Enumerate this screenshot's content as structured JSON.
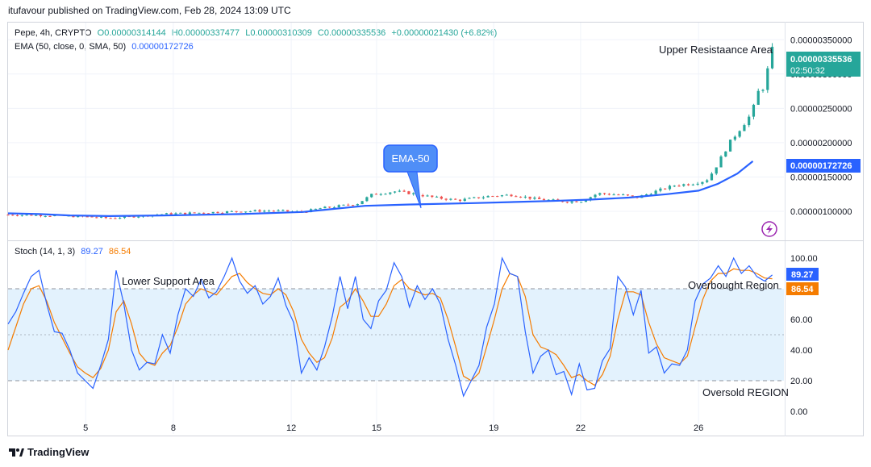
{
  "header": {
    "published": "itufavour published on TradingView.com, Feb 28, 2024 13:09 UTC"
  },
  "legend": {
    "symbol": "Pepe, 4h, CRYPTO",
    "open": "O0.00000314144",
    "high": "H0.00000337477",
    "low": "L0.00000310309",
    "close": "C0.00000335536",
    "change": "+0.00000021430 (+6.82%)",
    "ema_label": "EMA (50, close, 0, SMA, 50)",
    "ema_value": "0.00000172726",
    "stoch_label": "Stoch (14, 1, 3)",
    "stoch_k": "89.27",
    "stoch_d": "86.54"
  },
  "annotations": {
    "upper_resistance": "Upper Resistaance Area",
    "ema_callout": "EMA-50",
    "lower_support": "Lower Support Area",
    "overbought": "Overbought Region",
    "oversold": "Oversold REGION"
  },
  "price_badges": {
    "last_price": "0.00000335536",
    "countdown": "02:50:32",
    "ema_price": "0.00000172726"
  },
  "stoch_badges": {
    "k": "89.27",
    "d": "86.54"
  },
  "footer": {
    "brand": "TradingView"
  },
  "colors": {
    "up": "#26a69a",
    "down": "#ef5350",
    "ema": "#2962ff",
    "stoch_k": "#2962ff",
    "stoch_d": "#f57c00",
    "band": "#e3f2fd",
    "lightning": "#9c27b0"
  },
  "chart_data": [
    {
      "type": "candlestick",
      "title": "Pepe, 4h, CRYPTO",
      "x_tick_labels": [
        "5",
        "8",
        "12",
        "15",
        "19",
        "22",
        "26"
      ],
      "y_tick_labels": [
        "0.00000100000",
        "0.00000150000",
        "0.00000200000",
        "0.00000250000",
        "0.00000300000",
        "0.00000350000"
      ],
      "ylim": [
        6e-07,
        3.75e-06
      ],
      "grid": true,
      "series": [
        {
          "name": "EMA (50, close, 0, SMA, 50)",
          "x": [
            0,
            0.04,
            0.08,
            0.13,
            0.2,
            0.3,
            0.38,
            0.46,
            0.52,
            0.6,
            0.7,
            0.75,
            0.8,
            0.85,
            0.89,
            0.915,
            0.94,
            0.96
          ],
          "values": [
            9.7e-07,
            9.6e-07,
            9.4e-07,
            9.3e-07,
            9.4e-07,
            9.6e-07,
            9.9e-07,
            1.08e-06,
            1.1e-06,
            1.12e-06,
            1.15e-06,
            1.17e-06,
            1.2e-06,
            1.25e-06,
            1.3e-06,
            1.4e-06,
            1.55e-06,
            1.73e-06
          ]
        }
      ],
      "price_path": {
        "x": [
          0.0,
          0.05,
          0.1,
          0.13,
          0.17,
          0.2,
          0.25,
          0.3,
          0.34,
          0.38,
          0.4,
          0.45,
          0.47,
          0.5,
          0.52,
          0.55,
          0.58,
          0.62,
          0.65,
          0.68,
          0.7,
          0.72,
          0.74,
          0.76,
          0.79,
          0.81,
          0.84,
          0.86,
          0.88,
          0.9,
          0.91,
          0.92,
          0.93,
          0.94,
          0.95,
          0.96,
          0.965,
          0.97,
          0.975,
          0.98,
          0.985
        ],
        "values": [
          9.5e-07,
          9.4e-07,
          9.2e-07,
          9e-07,
          9.3e-07,
          9.6e-07,
          9.8e-07,
          1e-06,
          1.01e-06,
          9.9e-07,
          1.04e-06,
          1.11e-06,
          1.25e-06,
          1.29e-06,
          1.26e-06,
          1.2e-06,
          1.16e-06,
          1.22e-06,
          1.24e-06,
          1.18e-06,
          1.16e-06,
          1.14e-06,
          1.15e-06,
          1.26e-06,
          1.24e-06,
          1.2e-06,
          1.31e-06,
          1.38e-06,
          1.4e-06,
          1.45e-06,
          1.6e-06,
          1.8e-06,
          2e-06,
          2.15e-06,
          2.3e-06,
          2.45e-06,
          2.8e-06,
          2.65e-06,
          2.9e-06,
          3.1e-06,
          3.35e-06
        ]
      }
    },
    {
      "type": "line",
      "title": "Stoch (14, 1, 3)",
      "y_tick_labels": [
        "0.00",
        "20.00",
        "40.00",
        "60.00",
        "80.00",
        "100.00"
      ],
      "ylim": [
        0,
        100
      ],
      "bands": [
        20,
        50,
        80
      ],
      "series": [
        {
          "name": "%K",
          "values": [
            57,
            65,
            77,
            88,
            92,
            70,
            52,
            51,
            40,
            25,
            20,
            15,
            30,
            47,
            92,
            70,
            40,
            27,
            32,
            31,
            50,
            38,
            63,
            80,
            75,
            86,
            74,
            78,
            88,
            100,
            85,
            77,
            82,
            70,
            75,
            87,
            69,
            58,
            25,
            35,
            27,
            42,
            62,
            88,
            67,
            88,
            60,
            54,
            72,
            79,
            97,
            88,
            68,
            82,
            73,
            80,
            70,
            47,
            30,
            10,
            20,
            30,
            55,
            70,
            100,
            90,
            88,
            52,
            25,
            36,
            40,
            24,
            26,
            11,
            31,
            14,
            15,
            33,
            41,
            88,
            81,
            63,
            79,
            38,
            42,
            25,
            31,
            30,
            40,
            72,
            83,
            87,
            95,
            88,
            100,
            90,
            95,
            88,
            85,
            89
          ]
        },
        {
          "name": "%D",
          "values": [
            40,
            55,
            70,
            80,
            82,
            72,
            58,
            48,
            38,
            29,
            25,
            22,
            28,
            40,
            65,
            72,
            57,
            38,
            32,
            30,
            38,
            43,
            55,
            70,
            76,
            80,
            78,
            76,
            82,
            88,
            90,
            84,
            80,
            77,
            76,
            80,
            76,
            65,
            47,
            38,
            32,
            35,
            48,
            68,
            72,
            80,
            72,
            62,
            62,
            70,
            82,
            86,
            80,
            78,
            76,
            77,
            74,
            60,
            42,
            23,
            20,
            25,
            42,
            60,
            80,
            90,
            88,
            75,
            50,
            42,
            40,
            37,
            30,
            22,
            24,
            20,
            17,
            24,
            36,
            60,
            78,
            78,
            76,
            58,
            44,
            35,
            33,
            31,
            36,
            55,
            73,
            85,
            90,
            90,
            93,
            92,
            92,
            90,
            87,
            86.54
          ]
        }
      ]
    }
  ]
}
